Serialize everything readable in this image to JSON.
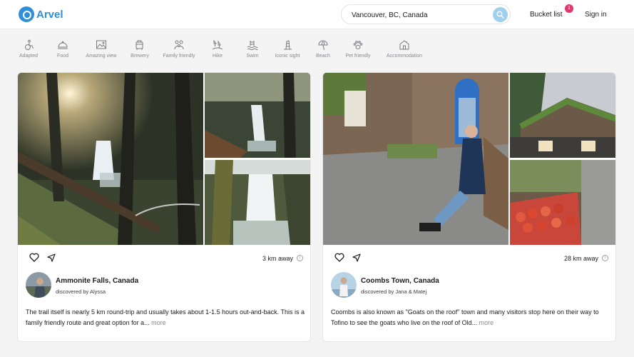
{
  "header": {
    "logo_text": "Arvel",
    "search_value": "Vancouver, BC, Canada",
    "bucket_label": "Bucket list",
    "bucket_count": "1",
    "signin_label": "Sign in"
  },
  "categories": [
    {
      "label": "Adapted",
      "icon": "wheelchair-icon"
    },
    {
      "label": "Food",
      "icon": "food-dome-icon"
    },
    {
      "label": "Amazing view",
      "icon": "landscape-view-icon"
    },
    {
      "label": "Brewery",
      "icon": "brewery-icon"
    },
    {
      "label": "Family friendly",
      "icon": "family-icon"
    },
    {
      "label": "Hike",
      "icon": "hike-icon"
    },
    {
      "label": "Swim",
      "icon": "swim-icon"
    },
    {
      "label": "Iconic sight",
      "icon": "landmark-icon"
    },
    {
      "label": "Beach",
      "icon": "beach-umbrella-icon"
    },
    {
      "label": "Pet friendly",
      "icon": "paw-icon"
    },
    {
      "label": "Accommodation",
      "icon": "house-icon"
    }
  ],
  "cards": [
    {
      "distance": "3 km away",
      "place": "Ammonite Falls, Canada",
      "discovered": "discovered by Alyssa",
      "description": "The trail itself is nearly 5 km round-trip and usually takes about 1-1.5 hours out-and-back. This is a family friendly route and great option for a...",
      "more": "more"
    },
    {
      "distance": "28 km away",
      "place": "Coombs Town, Canada",
      "discovered": "discovered by Jana & Matej",
      "description": "Coombs is also known as \"Goats on the roof\" town and many visitors stop here on their way to Tofino to see the goats who live on the roof of Old...",
      "more": "more"
    }
  ],
  "colors": {
    "brand": "#2f8fd8",
    "badge": "#e5356b",
    "search_button": "#9fd0ee"
  }
}
